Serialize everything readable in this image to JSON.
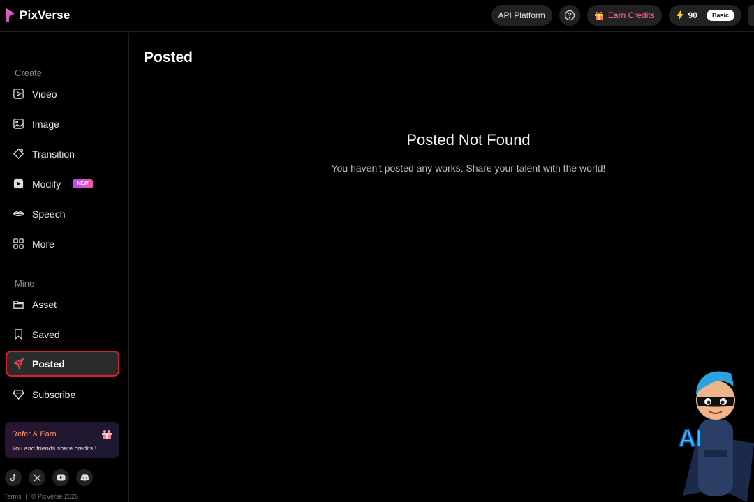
{
  "app": {
    "name": "PixVerse"
  },
  "topbar": {
    "api_label": "API Platform",
    "earn_label": "Earn Credits",
    "credits": "90",
    "plan": "Basic"
  },
  "sidebar": {
    "create_title": "Create",
    "create_items": [
      {
        "label": "Video",
        "icon": "video-icon"
      },
      {
        "label": "Image",
        "icon": "image-icon"
      },
      {
        "label": "Transition",
        "icon": "transition-icon"
      },
      {
        "label": "Modify",
        "icon": "modify-icon",
        "badge": "NEW"
      },
      {
        "label": "Speech",
        "icon": "lips-icon"
      },
      {
        "label": "More",
        "icon": "grid-icon"
      }
    ],
    "mine_title": "Mine",
    "mine_items": [
      {
        "label": "Asset",
        "icon": "folder-icon"
      },
      {
        "label": "Saved",
        "icon": "bookmark-icon"
      },
      {
        "label": "Posted",
        "icon": "send-icon",
        "active": true
      },
      {
        "label": "Subscribe",
        "icon": "diamond-icon"
      }
    ],
    "refer": {
      "title": "Refer & Earn",
      "subtitle": "You and friends share credits !"
    },
    "socials": [
      "tiktok-icon",
      "x-icon",
      "youtube-icon",
      "discord-icon"
    ],
    "footer": {
      "terms": "Terms",
      "copyright": "© PixVerse 2026"
    }
  },
  "main": {
    "title": "Posted",
    "empty_title": "Posted Not Found",
    "empty_subtitle": "You haven't posted any works. Share your talent with the world!"
  },
  "mascot": {
    "label": "AI"
  },
  "colors": {
    "accent": "#ff6aa0",
    "active_border": "#e11d2a",
    "background": "#000000"
  }
}
